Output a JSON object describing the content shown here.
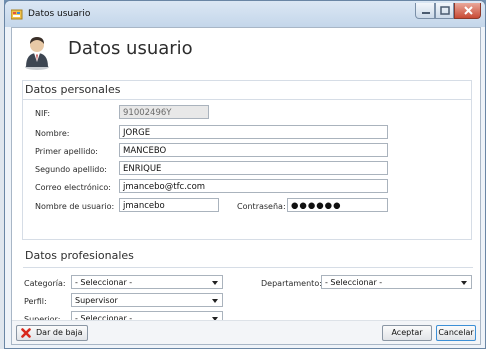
{
  "window": {
    "title": "Datos usuario"
  },
  "header": {
    "title": "Datos usuario"
  },
  "personal": {
    "title": "Datos personales",
    "nif": {
      "label": "NIF:",
      "value": "91002496Y"
    },
    "nombre": {
      "label": "Nombre:",
      "value": "JORGE"
    },
    "primer_apellido": {
      "label": "Primer apellido:",
      "value": "MANCEBO"
    },
    "segundo_apellido": {
      "label": "Segundo apellido:",
      "value": "ENRIQUE"
    },
    "correo": {
      "label": "Correo electrónico:",
      "value": "jmancebo@tfc.com"
    },
    "usuario": {
      "label": "Nombre de usuario:",
      "value": "jmancebo"
    },
    "contrasena": {
      "label": "Contraseña:",
      "value": "●●●●●●"
    }
  },
  "profesional": {
    "title": "Datos profesionales",
    "categoria": {
      "label": "Categoría:",
      "value": "- Seleccionar -"
    },
    "departamento": {
      "label": "Departamento:",
      "value": "- Seleccionar -"
    },
    "perfil": {
      "label": "Perfil:",
      "value": "Supervisor"
    },
    "superior": {
      "label": "Superior:",
      "value": "- Seleccionar -"
    }
  },
  "footer": {
    "baja_label": "Dar de baja",
    "aceptar_label": "Aceptar",
    "cancelar_label": "Cancelar"
  },
  "icons": {
    "app": "window-app-icon",
    "header": "user-icon",
    "baja": "red-x-icon",
    "dropdown": "chevron-down-icon"
  },
  "colors": {
    "accent": "#3c8fd6",
    "close_button": "#c94a35"
  }
}
